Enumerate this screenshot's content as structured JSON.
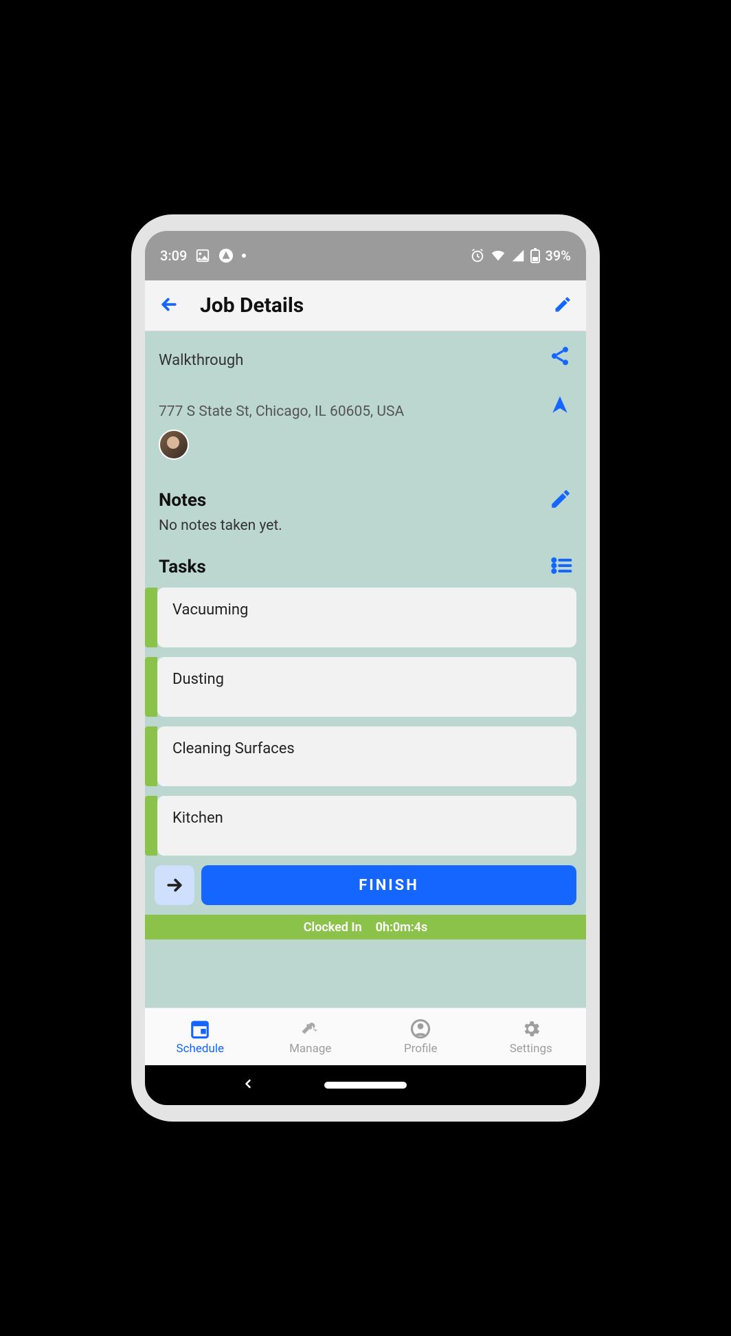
{
  "status_bar": {
    "time": "3:09",
    "battery_pct": "39%"
  },
  "header": {
    "title": "Job Details"
  },
  "job": {
    "name": "Walkthrough",
    "address": "777 S State St, Chicago, IL 60605, USA"
  },
  "notes": {
    "heading": "Notes",
    "body": "No notes taken yet."
  },
  "tasks_heading": "Tasks",
  "tasks": [
    {
      "label": "Vacuuming"
    },
    {
      "label": "Dusting"
    },
    {
      "label": "Cleaning Surfaces"
    },
    {
      "label": "Kitchen"
    }
  ],
  "finish_label": "FINISH",
  "clock": {
    "status": "Clocked In",
    "elapsed": "0h:0m:4s"
  },
  "tabs": [
    {
      "label": "Schedule"
    },
    {
      "label": "Manage"
    },
    {
      "label": "Profile"
    },
    {
      "label": "Settings"
    }
  ]
}
